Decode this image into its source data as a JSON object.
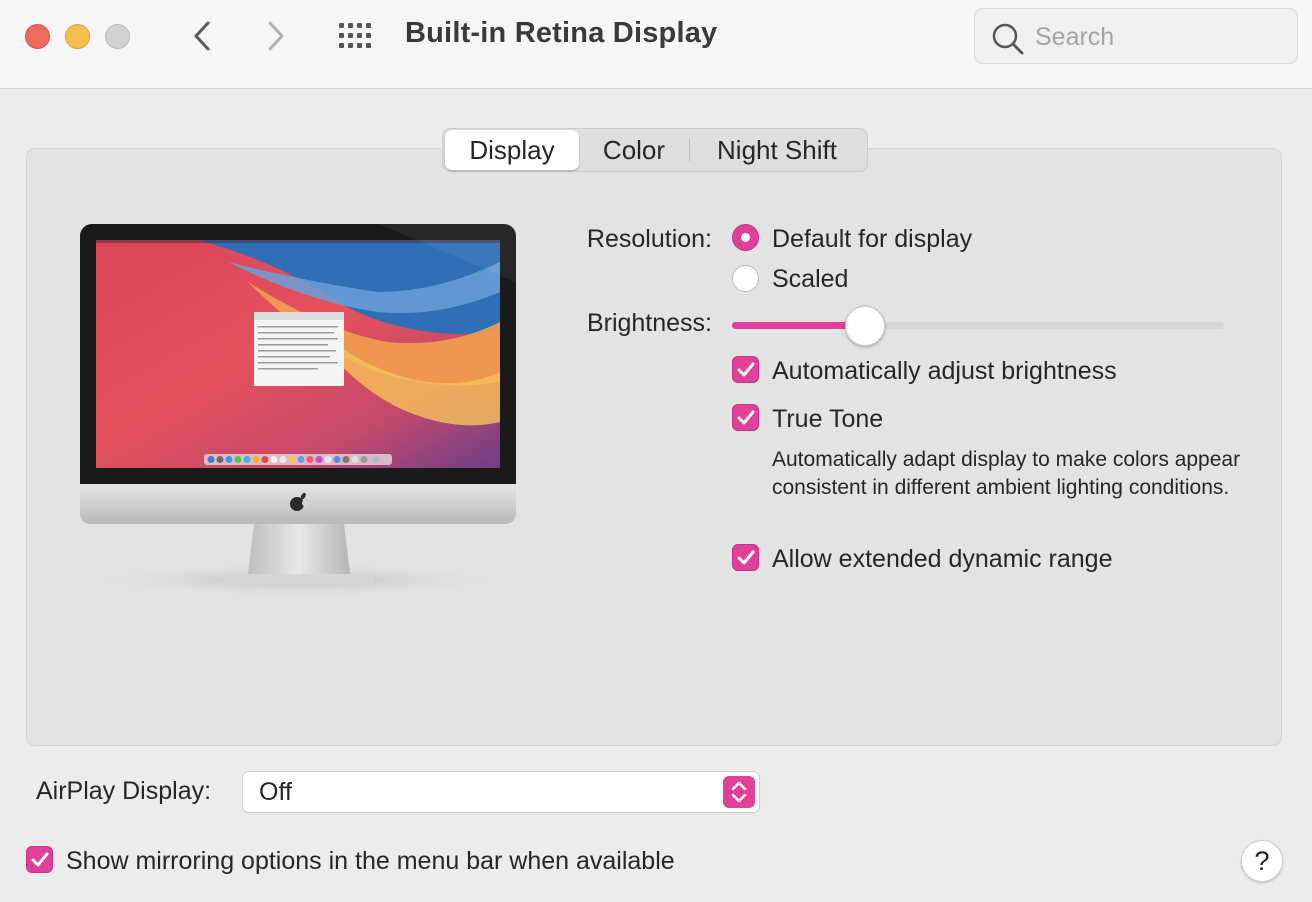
{
  "window": {
    "title": "Built-in Retina Display"
  },
  "search": {
    "placeholder": "Search"
  },
  "tabs": {
    "display": "Display",
    "color": "Color",
    "night_shift": "Night Shift",
    "selected": "Display"
  },
  "settings": {
    "resolution_label": "Resolution:",
    "resolution_options": [
      "Default for display",
      "Scaled"
    ],
    "resolution_selected": "Default for display",
    "brightness_label": "Brightness:",
    "brightness_level": 0.27,
    "auto_brightness_label": "Automatically adjust brightness",
    "auto_brightness_checked": true,
    "true_tone_label": "True Tone",
    "true_tone_checked": true,
    "true_tone_description": "Automatically adapt display to make colors appear consistent in different ambient lighting conditions.",
    "edr_label": "Allow extended dynamic range",
    "edr_checked": true
  },
  "airplay": {
    "label": "AirPlay Display:",
    "value": "Off"
  },
  "mirroring": {
    "label": "Show mirroring options in the menu bar when available",
    "checked": true
  },
  "help": {
    "label": "?"
  },
  "icons": {
    "back": "chevron-left-icon",
    "forward": "chevron-right-icon",
    "show_all": "grid-icon",
    "search": "search-icon",
    "checkbox": "checkmark-icon",
    "stepper": "up-down-chevron-icon"
  },
  "colors": {
    "accent": "#e0409a",
    "close": "#ed6a5e",
    "minimize": "#f5bf4f",
    "zoom_disabled": "#d2d2d2"
  }
}
